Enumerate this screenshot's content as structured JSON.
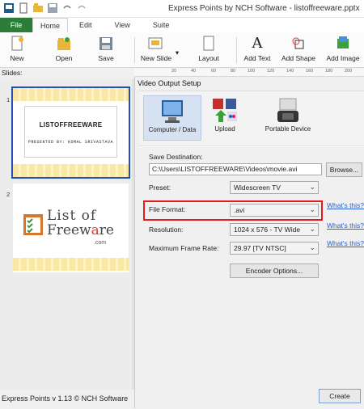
{
  "window": {
    "title": "Express Points by NCH Software - listoffreeware.pptx"
  },
  "menu_tabs": [
    "File",
    "Home",
    "Edit",
    "View",
    "Suite"
  ],
  "ribbon": {
    "new": "New",
    "open": "Open",
    "save": "Save",
    "new_slide": "New Slide",
    "layout": "Layout",
    "add_text": "Add Text",
    "add_shape": "Add Shape",
    "add_image": "Add Image"
  },
  "slides_panel": {
    "header": "Slides:",
    "slide1": {
      "number": "1",
      "title": "LISTOFFREEWARE",
      "subtitle": "PRESENTED BY: KOMAL SRIVASTAVA"
    },
    "slide2": {
      "number": "2",
      "logo_line1": "List of",
      "logo_line2a": "Freew",
      "logo_line2b": "a",
      "logo_line2c": "re",
      "logo_com": ".com"
    }
  },
  "ruler": {
    "ticks": [
      "20",
      "40",
      "60",
      "80",
      "100",
      "120",
      "140",
      "160",
      "180",
      "200"
    ]
  },
  "dialog": {
    "title": "Video Output Setup",
    "tools": {
      "computer": "Computer / Data",
      "upload": "Upload",
      "portable": "Portable Device"
    },
    "save_destination_label": "Save Destination:",
    "save_destination_value": "C:\\Users\\LISTOFFREEWARE\\Videos\\movie.avi",
    "browse": "Browse...",
    "preset_label": "Preset:",
    "preset_value": "Widescreen TV",
    "file_format_label": "File Format:",
    "file_format_value": ".avi",
    "resolution_label": "Resolution:",
    "resolution_value": "1024 x 576 - TV Wide",
    "frame_rate_label": "Maximum Frame Rate:",
    "frame_rate_value": "29.97 [TV NTSC]",
    "whats_this": "What's this?",
    "encoder_options": "Encoder Options...",
    "create": "Create"
  },
  "status": {
    "text": "Express Points v 1.13 © NCH Software"
  },
  "colors": {
    "file_tab": "#2c7c3a",
    "highlight": "#e21b1b",
    "selection": "#2350b8",
    "link": "#2a5fd0"
  }
}
